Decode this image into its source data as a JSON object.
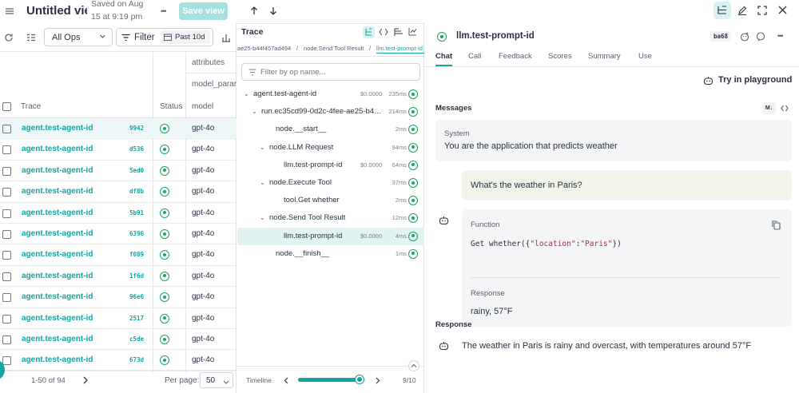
{
  "header": {
    "title": "Untitled view",
    "saved_line1": "Saved on  Aug",
    "saved_line2": "15 at 9:19 pm",
    "more": "•••",
    "save_view": "Save view"
  },
  "toolbar": {
    "ops_select": "All Ops",
    "filter": "Filter",
    "date_range": "Past 10d"
  },
  "table": {
    "col_attributes": "attributes",
    "col_model_params": "model_param",
    "col_trace": "Trace",
    "col_status": "Status",
    "col_model": "model",
    "rows": [
      {
        "trace": "agent.test-agent-id",
        "hash": "9942",
        "model": "gpt-4o"
      },
      {
        "trace": "agent.test-agent-id",
        "hash": "d536",
        "model": "gpt-4o"
      },
      {
        "trace": "agent.test-agent-id",
        "hash": "5ed0",
        "model": "gpt-4o"
      },
      {
        "trace": "agent.test-agent-id",
        "hash": "df8b",
        "model": "gpt-4o"
      },
      {
        "trace": "agent.test-agent-id",
        "hash": "5b91",
        "model": "gpt-4o"
      },
      {
        "trace": "agent.test-agent-id",
        "hash": "6396",
        "model": "gpt-4o"
      },
      {
        "trace": "agent.test-agent-id",
        "hash": "f089",
        "model": "gpt-4o"
      },
      {
        "trace": "agent.test-agent-id",
        "hash": "1f6d",
        "model": "gpt-4o"
      },
      {
        "trace": "agent.test-agent-id",
        "hash": "96e6",
        "model": "gpt-4o"
      },
      {
        "trace": "agent.test-agent-id",
        "hash": "2517",
        "model": "gpt-4o"
      },
      {
        "trace": "agent.test-agent-id",
        "hash": "c5de",
        "model": "gpt-4o"
      },
      {
        "trace": "agent.test-agent-id",
        "hash": "673d",
        "model": "gpt-4o"
      }
    ]
  },
  "pagination": {
    "range": "1-50 of 94",
    "per_page_label": "Per page:",
    "per_page_value": "50"
  },
  "trace_panel": {
    "title": "Trace",
    "breadcrumbs": [
      "ae25-b44f457ad494",
      "node.Send Tool Result",
      "llm.test-prompt-id"
    ],
    "filter_placeholder": "Filter by op name...",
    "nodes": [
      {
        "label": "agent.test-agent-id",
        "cost": "$0.0000",
        "dur": "235ms",
        "indent": 0,
        "caret": true
      },
      {
        "label": "run.ec35cd99-0d2c-4fee-ae25-b4…",
        "cost": "",
        "dur": "214ms",
        "indent": 1,
        "caret": true
      },
      {
        "label": "node.__start__",
        "cost": "",
        "dur": "2ms",
        "indent": 2,
        "caret": false
      },
      {
        "label": "node.LLM Request",
        "cost": "",
        "dur": "94ms",
        "indent": 2,
        "caret": true
      },
      {
        "label": "llm.test-prompt-id",
        "cost": "$0.0000",
        "dur": "64ms",
        "indent": 3,
        "caret": false
      },
      {
        "label": "node.Execute Tool",
        "cost": "",
        "dur": "37ms",
        "indent": 2,
        "caret": true
      },
      {
        "label": "tool.Get whether",
        "cost": "",
        "dur": "2ms",
        "indent": 3,
        "caret": false
      },
      {
        "label": "node.Send Tool Result",
        "cost": "",
        "dur": "12ms",
        "indent": 2,
        "caret": true
      },
      {
        "label": "llm.test-prompt-id",
        "cost": "$0.0000",
        "dur": "4ms",
        "indent": 3,
        "caret": false,
        "selected": true
      },
      {
        "label": "node.__finish__",
        "cost": "",
        "dur": "1ms",
        "indent": 2,
        "caret": false
      }
    ],
    "timeline_label": "Timeline",
    "timeline_count": "9/10",
    "timeline_progress": 0.9
  },
  "detail": {
    "title": "llm.test-prompt-id",
    "badge": "ba68",
    "tabs": [
      "Chat",
      "Call",
      "Feedback",
      "Scores",
      "Summary",
      "Use"
    ],
    "try_playground": "Try in playground",
    "messages_label": "Messages",
    "md_badge": "M↓",
    "system_role": "System",
    "system_text": "You are the application that predicts weather",
    "user_text": "What's the weather in Paris?",
    "function_label": "Function",
    "function_name": "Get whether",
    "function_args_open": "({",
    "function_key": "\"location\"",
    "function_colon": ":",
    "function_value": "\"Paris\"",
    "function_args_close": "})",
    "response_label": "Response",
    "response_value": "rainy, 57°F",
    "final_response_label": "Response",
    "final_response_text": "The weather in Paris is rainy and overcast, with temperatures around 57°F"
  }
}
